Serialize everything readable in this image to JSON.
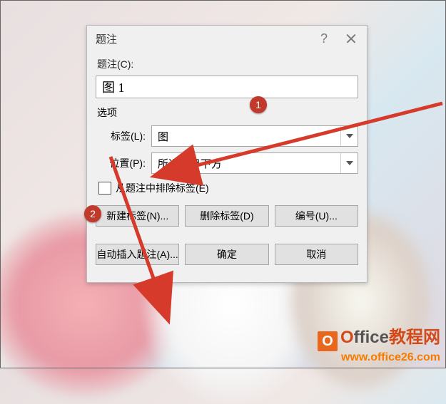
{
  "dialog": {
    "title": "题注",
    "caption_label": "题注(C):",
    "caption_value": "图 1",
    "options_header": "选项",
    "label_row": {
      "label": "标签(L):",
      "value": "图"
    },
    "position_row": {
      "label": "位置(P):",
      "value": "所选项目下方"
    },
    "exclude_checkbox": "从题注中排除标签(E)",
    "buttons": {
      "new_label": "新建标签(N)...",
      "delete_label": "删除标签(D)",
      "numbering": "编号(U)...",
      "auto_caption": "自动插入题注(A)...",
      "ok": "确定",
      "cancel": "取消"
    }
  },
  "annotations": {
    "badge1": "1",
    "badge2": "2"
  },
  "watermark": {
    "brand_first": "O",
    "brand_rest": "ffice",
    "brand_cn": "教程网",
    "url": "www.office26.com"
  }
}
